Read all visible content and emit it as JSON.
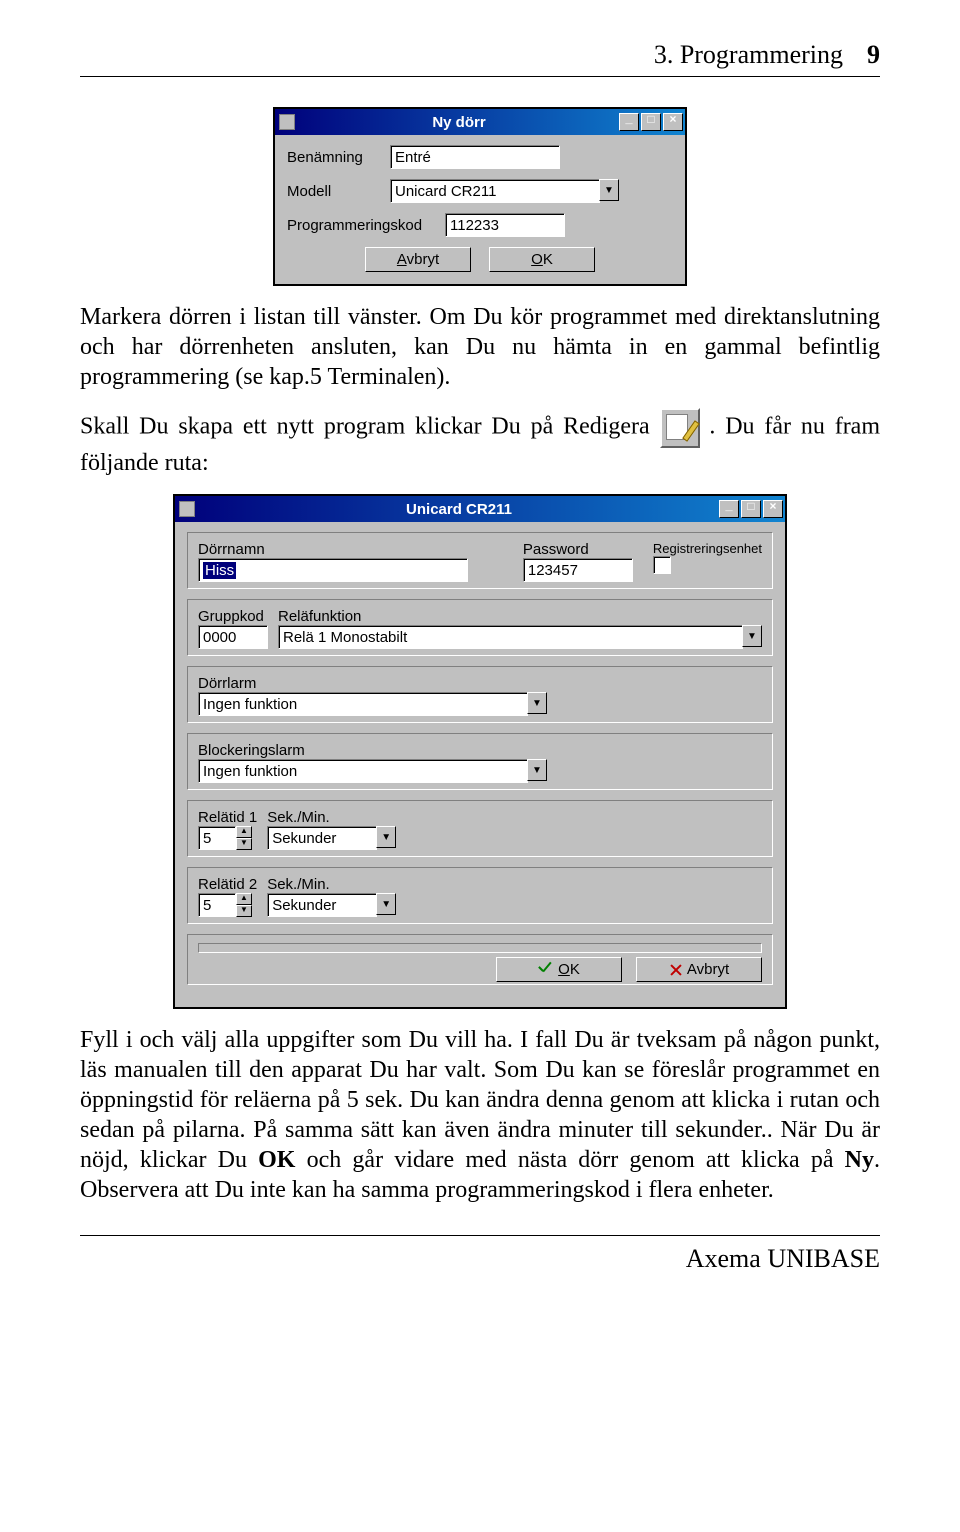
{
  "header": {
    "title": "3. Programmering",
    "page": "9"
  },
  "para1": "Markera dörren i listan till vänster. Om Du kör programmet med direktanslutning och har dörrenheten ansluten, kan Du nu hämta in en gammal befintlig programmering (se kap.5 Terminalen).",
  "win1": {
    "title": "Ny dörr",
    "label_benamning": "Benämning",
    "value_benamning": "Entré",
    "label_modell": "Modell",
    "value_modell": "Unicard CR211",
    "label_progkod": "Programmeringskod",
    "value_progkod": "112233",
    "btn_cancel": "Avbryt",
    "btn_ok": "OK"
  },
  "para2a": "Skall Du skapa ett nytt program klickar Du på Redigera ",
  "para2b": ". Du får nu fram följande ruta:",
  "win2": {
    "title": "Unicard CR211",
    "label_dorrnamn": "Dörrnamn",
    "value_dorrnamn": "Hiss",
    "label_password": "Password",
    "value_password": "123457",
    "label_regenhet": "Registreringsenhet",
    "label_gruppkod": "Gruppkod",
    "value_gruppkod": "0000",
    "label_relafunktion": "Reläfunktion",
    "value_relafunktion": "Relä 1 Monostabilt",
    "label_dorrlarm": "Dörrlarm",
    "value_dorrlarm": "Ingen funktion",
    "label_blockeringslarm": "Blockeringslarm",
    "value_blockeringslarm": "Ingen funktion",
    "label_relatid1": "Relätid 1",
    "label_relatid2": "Relätid 2",
    "label_sekmin": "Sek./Min.",
    "value_relatid": "5",
    "value_sekmin": "Sekunder",
    "btn_ok": "OK",
    "btn_cancel": "Avbryt"
  },
  "para3_before_ok": "Fyll i och välj alla uppgifter som Du vill ha. I fall Du är tveksam på någon punkt, läs manualen till den apparat Du har valt. Som Du kan se föreslår programmet en öppningstid för reläerna på 5 sek. Du kan ändra denna genom att klicka i rutan och sedan på pilarna. På samma sätt kan även ändra minuter till sekunder.. När Du är nöjd, klickar Du ",
  "para3_ok": "OK",
  "para3_mid": " och går vidare med nästa dörr genom att klicka på ",
  "para3_ny": "Ny",
  "para3_after_ny": ". Observera att Du inte kan ha samma programmeringskod i flera enheter.",
  "footer": "Axema UNIBASE"
}
